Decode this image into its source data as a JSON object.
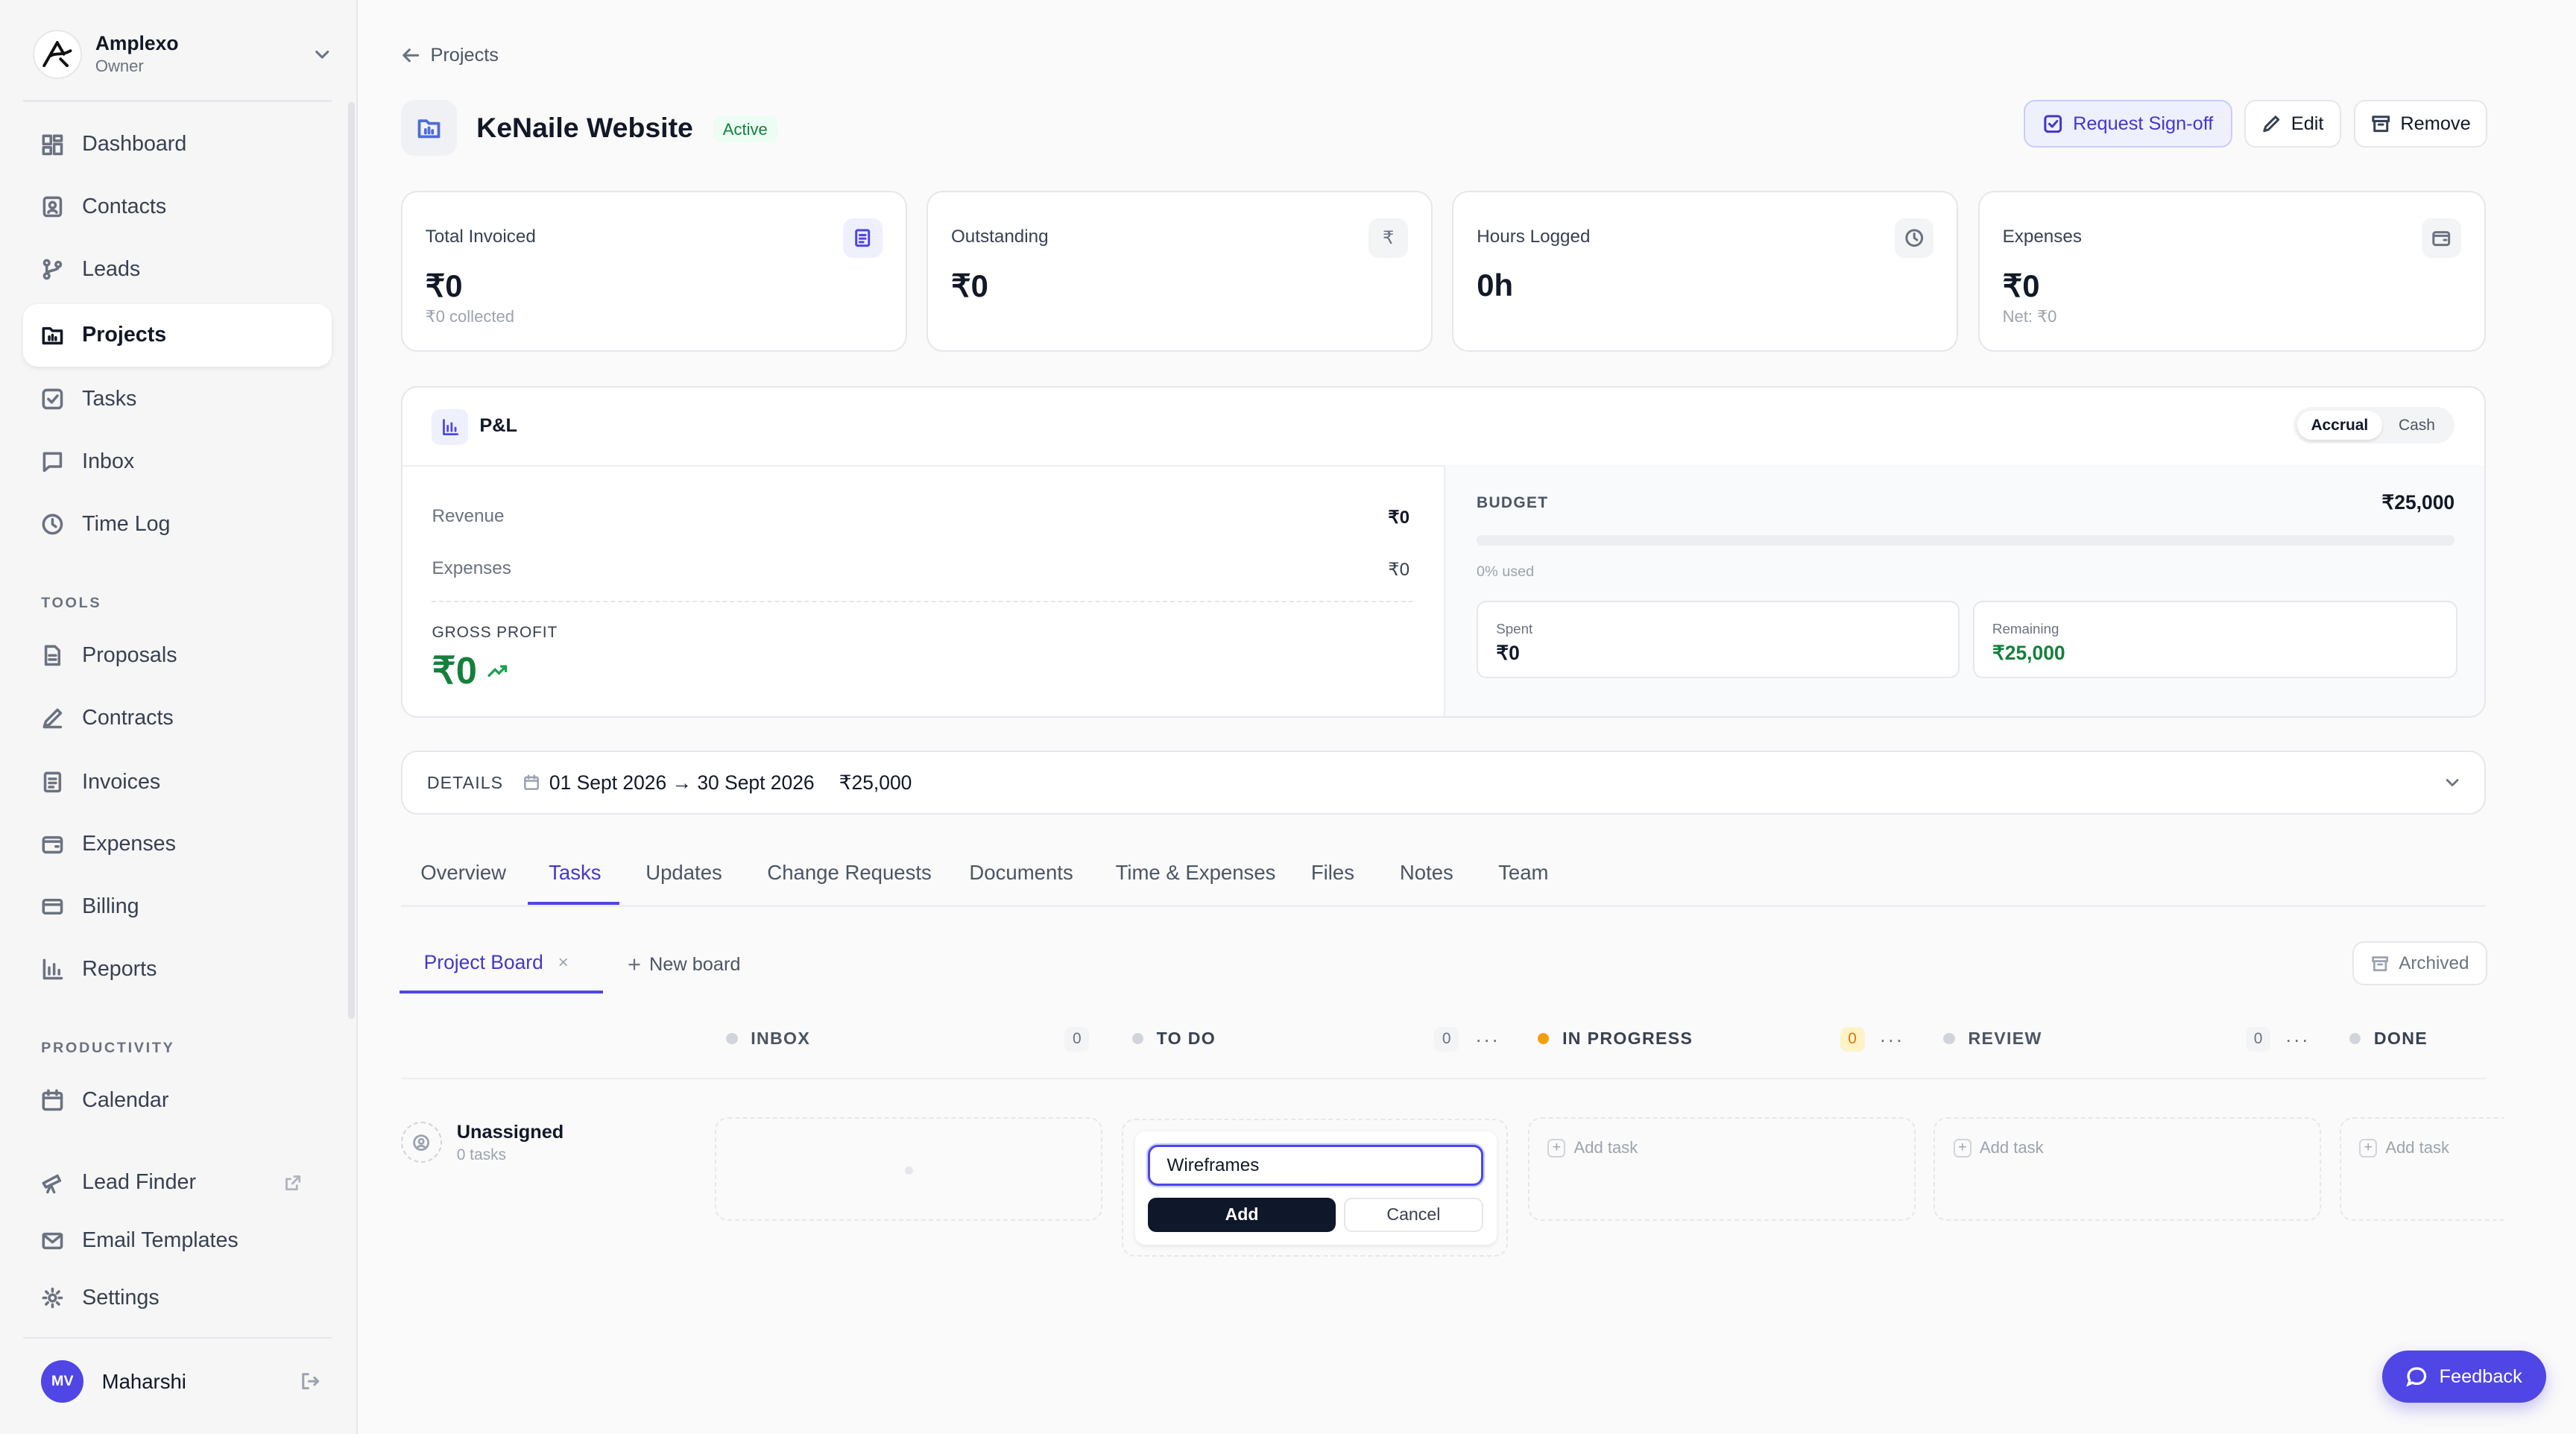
{
  "org": {
    "name": "Amplexo",
    "role": "Owner"
  },
  "nav": {
    "dashboard": "Dashboard",
    "contacts": "Contacts",
    "leads": "Leads",
    "projects": "Projects",
    "tasks": "Tasks",
    "inbox": "Inbox",
    "timelog": "Time Log"
  },
  "sections": {
    "tools": "TOOLS",
    "productivity": "PRODUCTIVITY"
  },
  "tools": {
    "proposals": "Proposals",
    "contracts": "Contracts",
    "invoices": "Invoices",
    "expenses": "Expenses",
    "billing": "Billing",
    "reports": "Reports"
  },
  "productivity": {
    "calendar": "Calendar",
    "lead_finder": "Lead Finder",
    "email_templates": "Email Templates",
    "settings": "Settings"
  },
  "user": {
    "initials": "MV",
    "name": "Maharshi"
  },
  "breadcrumb": "Projects",
  "project": {
    "title": "KeNaile Website",
    "status": "Active"
  },
  "actions": {
    "signoff": "Request Sign-off",
    "edit": "Edit",
    "remove": "Remove"
  },
  "stats": {
    "invoiced": {
      "label": "Total Invoiced",
      "value": "₹0",
      "sub": "₹0 collected"
    },
    "outstanding": {
      "label": "Outstanding",
      "value": "₹0"
    },
    "hours": {
      "label": "Hours Logged",
      "value": "0h"
    },
    "expenses": {
      "label": "Expenses",
      "value": "₹0",
      "sub": "Net: ₹0"
    }
  },
  "pl": {
    "title": "P&L",
    "toggle_accrual": "Accrual",
    "toggle_cash": "Cash",
    "revenue_label": "Revenue",
    "revenue_value": "₹0",
    "expenses_label": "Expenses",
    "expenses_value": "₹0",
    "gross_label": "GROSS PROFIT",
    "gross_value": "₹0",
    "budget_label": "BUDGET",
    "budget_value": "₹25,000",
    "budget_used_text": "0% used",
    "budget_used_fraction": 0,
    "spent_label": "Spent",
    "spent_value": "₹0",
    "remaining_label": "Remaining",
    "remaining_value": "₹25,000"
  },
  "details": {
    "label": "DETAILS",
    "dates": "01 Sept 2026 → 30 Sept 2026",
    "amount": "₹25,000"
  },
  "tabs": {
    "overview": "Overview",
    "tasks": "Tasks",
    "updates": "Updates",
    "change_requests": "Change Requests",
    "documents": "Documents",
    "time_expenses": "Time & Expenses",
    "files": "Files",
    "notes": "Notes",
    "team": "Team"
  },
  "board": {
    "name": "Project Board",
    "new_board": "New board",
    "archived": "Archived"
  },
  "columns": {
    "inbox": {
      "title": "INBOX",
      "count": "0"
    },
    "todo": {
      "title": "TO DO",
      "count": "0"
    },
    "in_progress": {
      "title": "IN PROGRESS",
      "count": "0"
    },
    "review": {
      "title": "REVIEW",
      "count": "0"
    },
    "done": {
      "title": "DONE"
    }
  },
  "colors": {
    "in_progress": "#f59e0b",
    "accent": "#4f46e5",
    "profit": "#15803d"
  },
  "swimlane": {
    "name": "Unassigned",
    "count": "0 tasks"
  },
  "new_task": {
    "value": "Wireframes",
    "add": "Add",
    "cancel": "Cancel"
  },
  "add_task": "Add task",
  "feedback": "Feedback"
}
